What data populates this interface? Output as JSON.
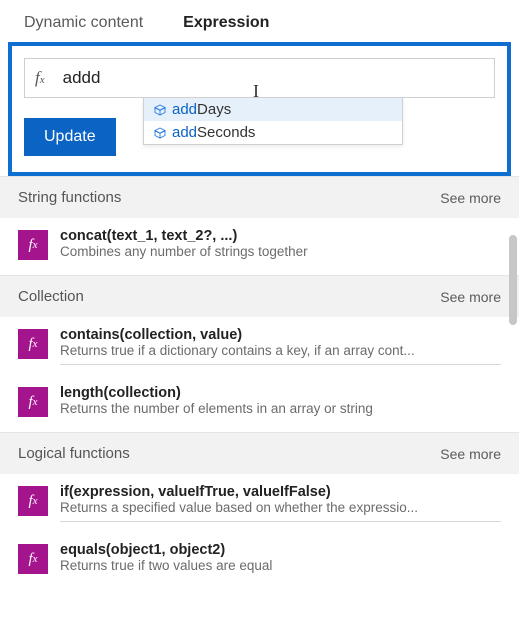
{
  "tabs": {
    "dynamic": "Dynamic content",
    "expression": "Expression"
  },
  "formula": {
    "fx_label": "f",
    "fx_sub": "x",
    "input_value": "addd",
    "autocomplete": [
      {
        "prefix": "add",
        "rest": "Days",
        "selected": true
      },
      {
        "prefix": "add",
        "rest": "Seconds",
        "selected": false
      }
    ],
    "update_label": "Update"
  },
  "sections": [
    {
      "title": "String functions",
      "see_more": "See more",
      "items": [
        {
          "sig": "concat(text_1, text_2?, ...)",
          "desc": "Combines any number of strings together"
        }
      ]
    },
    {
      "title": "Collection",
      "see_more": "See more",
      "items": [
        {
          "sig": "contains(collection, value)",
          "desc": "Returns true if a dictionary contains a key, if an array cont..."
        },
        {
          "sig": "length(collection)",
          "desc": "Returns the number of elements in an array or string"
        }
      ]
    },
    {
      "title": "Logical functions",
      "see_more": "See more",
      "items": [
        {
          "sig": "if(expression, valueIfTrue, valueIfFalse)",
          "desc": "Returns a specified value based on whether the expressio..."
        },
        {
          "sig": "equals(object1, object2)",
          "desc": "Returns true if two values are equal"
        }
      ]
    }
  ],
  "icons": {
    "fx_badge": "fx"
  },
  "colors": {
    "accent": "#0b63c4",
    "badge": "#a4158d",
    "highlight_border": "#0e6fd0"
  }
}
